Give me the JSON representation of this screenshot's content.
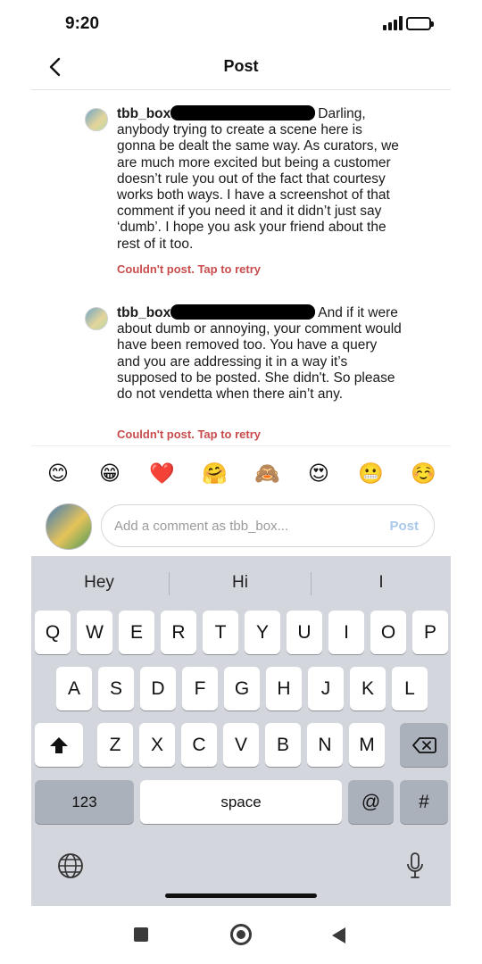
{
  "status_bar": {
    "time": "9:20"
  },
  "nav": {
    "title": "Post"
  },
  "comments": [
    {
      "username": "tbb_box",
      "text": "Darling, anybody trying to create a scene here is gonna be dealt the same way. As curators, we are much more excited but being a customer doesn’t rule you out of the fact that courtesy works both ways. I have a screenshot of that comment if you need it and it didn’t just say ‘dumb’. I  hope you ask your friend about the rest of it too.",
      "status": "Couldn't post. Tap to retry"
    },
    {
      "username": "tbb_box",
      "text": "And if it were about dumb or annoying, your comment would have been removed too. You have a query and you are addressing it in a way it’s supposed to be posted. She didn't. So please do not vendetta when there ain’t any.",
      "status": "Couldn't post. Tap to retry"
    }
  ],
  "emoji_bar": [
    {
      "name": "smiling-face",
      "glyph": "😊"
    },
    {
      "name": "grinning-face",
      "glyph": "😁"
    },
    {
      "name": "red-heart",
      "glyph": "❤️"
    },
    {
      "name": "hugging-face",
      "glyph": "🤗"
    },
    {
      "name": "see-no-evil-monkey",
      "glyph": "🙈"
    },
    {
      "name": "heart-eyes-face",
      "glyph": "😍"
    },
    {
      "name": "grimacing-face",
      "glyph": "😬"
    },
    {
      "name": "relieved-face",
      "glyph": "☺️"
    }
  ],
  "comment_input": {
    "placeholder": "Add a comment as tbb_box...",
    "value": "",
    "post_label": "Post"
  },
  "keyboard": {
    "suggestions": [
      "Hey",
      "Hi",
      "I"
    ],
    "row1": [
      "Q",
      "W",
      "E",
      "R",
      "T",
      "Y",
      "U",
      "I",
      "O",
      "P"
    ],
    "row2": [
      "A",
      "S",
      "D",
      "F",
      "G",
      "H",
      "J",
      "K",
      "L"
    ],
    "row3": [
      "Z",
      "X",
      "C",
      "V",
      "B",
      "N",
      "M"
    ],
    "numbers_label": "123",
    "space_label": "space",
    "at_label": "@",
    "hash_label": "#"
  },
  "colors": {
    "error": "#c94c4c",
    "post_disabled": "#a9c8ea",
    "keyboard_bg": "#d3d6dd",
    "battery": "#f2c94c"
  }
}
